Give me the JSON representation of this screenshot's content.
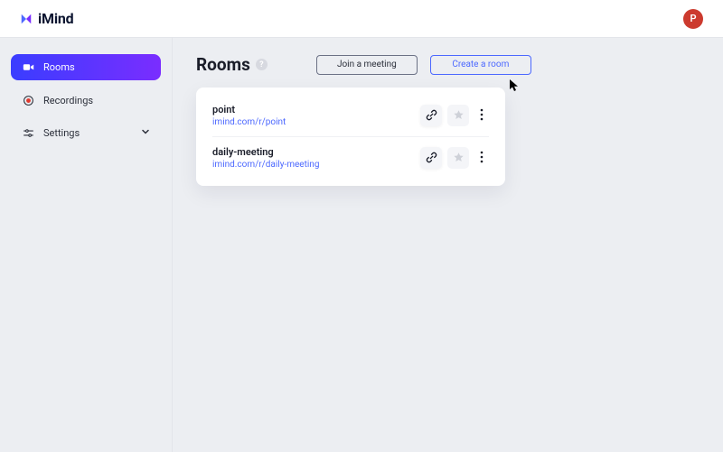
{
  "header": {
    "brand": "iMind",
    "avatar_initial": "P"
  },
  "sidebar": {
    "items": [
      {
        "label": "Rooms"
      },
      {
        "label": "Recordings"
      },
      {
        "label": "Settings"
      }
    ]
  },
  "page": {
    "title": "Rooms",
    "help_glyph": "?"
  },
  "actions": {
    "join_label": "Join a meeting",
    "create_label": "Create a room"
  },
  "rooms": [
    {
      "name": "point",
      "url": "imind.com/r/point"
    },
    {
      "name": "daily-meeting",
      "url": "imind.com/r/daily-meeting"
    }
  ]
}
